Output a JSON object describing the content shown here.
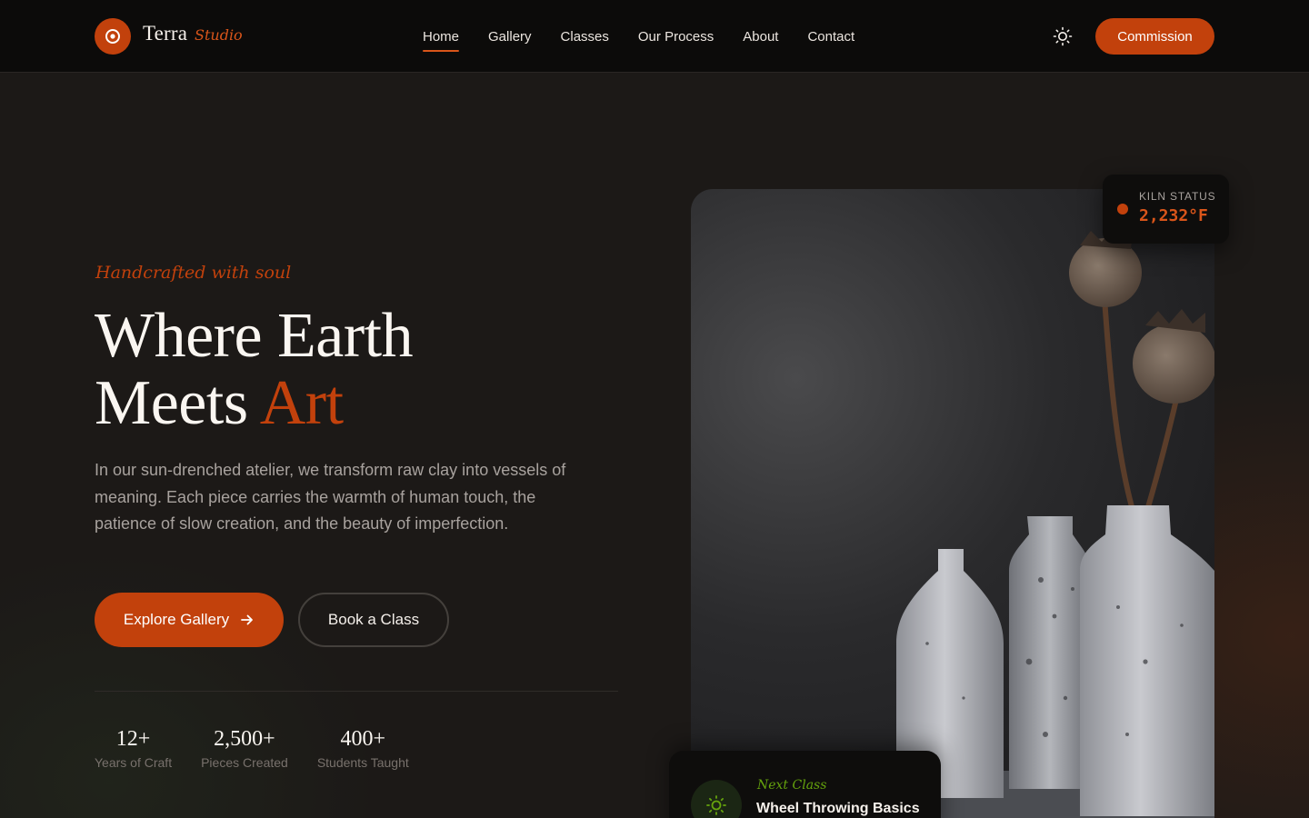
{
  "brand": {
    "name": "Terra",
    "sub": "Studio",
    "logo_icon": "location-pin-icon"
  },
  "nav": {
    "items": [
      {
        "label": "Home",
        "active": true
      },
      {
        "label": "Gallery"
      },
      {
        "label": "Classes"
      },
      {
        "label": "Our Process"
      },
      {
        "label": "About"
      },
      {
        "label": "Contact"
      }
    ]
  },
  "header": {
    "theme_icon": "sun-icon",
    "commission_label": "Commission"
  },
  "hero": {
    "eyebrow": "Handcrafted with soul",
    "title_line1": "Where Earth",
    "title_line2_prefix": "Meets",
    "title_line2_accent": "Art",
    "intro": "In our sun-drenched atelier, we transform raw clay into vessels of meaning. Each piece carries the warmth of human touch, the patience of slow creation, and the beauty of imperfection.",
    "primary_cta": "Explore Gallery",
    "secondary_cta": "Book a Class"
  },
  "stats": [
    {
      "value": "12+",
      "label": "Years of Craft"
    },
    {
      "value": "2,500+",
      "label": "Pieces Created"
    },
    {
      "value": "400+",
      "label": "Students Taught"
    }
  ],
  "kiln": {
    "label": "KILN STATUS",
    "value": "2,232°F"
  },
  "next_class": {
    "eyebrow": "Next Class",
    "title": "Wheel Throwing Basics"
  },
  "colors": {
    "accent": "#c2410c",
    "background": "#1c1917",
    "header": "#0c0b0a",
    "green": "#65a30d"
  }
}
